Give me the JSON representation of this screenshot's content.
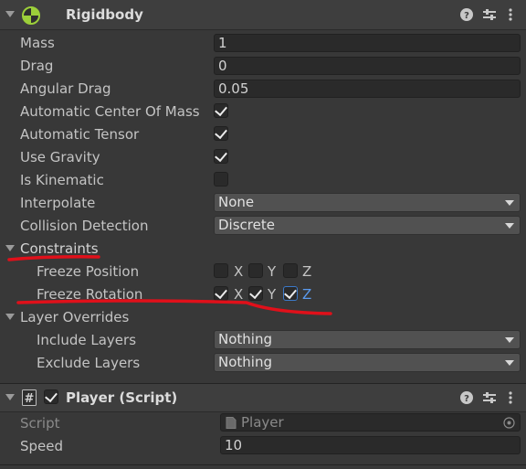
{
  "rigidbody": {
    "title": "Rigidbody",
    "fields": {
      "mass": {
        "label": "Mass",
        "value": "1"
      },
      "drag": {
        "label": "Drag",
        "value": "0"
      },
      "angular_drag": {
        "label": "Angular Drag",
        "value": "0.05"
      },
      "auto_com": {
        "label": "Automatic Center Of Mass",
        "checked": true
      },
      "auto_tensor": {
        "label": "Automatic Tensor",
        "checked": true
      },
      "use_gravity": {
        "label": "Use Gravity",
        "checked": true
      },
      "is_kinematic": {
        "label": "Is Kinematic",
        "checked": false
      },
      "interpolate": {
        "label": "Interpolate",
        "value": "None"
      },
      "collision": {
        "label": "Collision Detection",
        "value": "Discrete"
      }
    },
    "constraints": {
      "label": "Constraints",
      "freeze_position": {
        "label": "Freeze Position",
        "x": false,
        "y": false,
        "z": false
      },
      "freeze_rotation": {
        "label": "Freeze Rotation",
        "x": true,
        "y": true,
        "z": true
      },
      "axis_x": "X",
      "axis_y": "Y",
      "axis_z": "Z"
    },
    "layer_overrides": {
      "label": "Layer Overrides",
      "include": {
        "label": "Include Layers",
        "value": "Nothing"
      },
      "exclude": {
        "label": "Exclude Layers",
        "value": "Nothing"
      }
    }
  },
  "player_script": {
    "title": "Player (Script)",
    "enabled": true,
    "script": {
      "label": "Script",
      "value": "Player"
    },
    "speed": {
      "label": "Speed",
      "value": "10"
    }
  },
  "colors": {
    "annotation_red": "#e0101a",
    "focus_blue": "#3b79c9"
  }
}
